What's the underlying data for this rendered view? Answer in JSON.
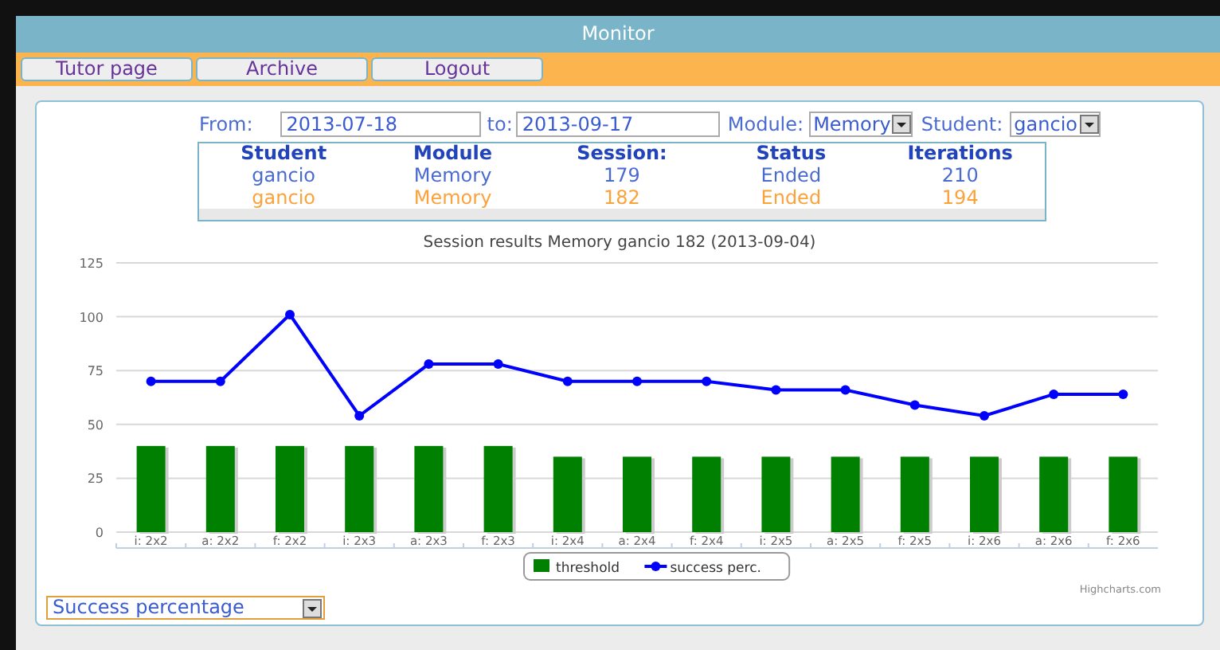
{
  "window": {
    "title": "Monitor"
  },
  "nav": [
    "Tutor page",
    "Archive",
    "Logout"
  ],
  "filters": {
    "from_label": "From:",
    "from": "2013-07-18",
    "to_label": "to:",
    "to": "2013-09-17",
    "module_label": "Module:",
    "module": "Memory",
    "student_label": "Student:",
    "student": "gancio"
  },
  "sessions": {
    "columns": [
      "Student",
      "Module",
      "Session:",
      "Status",
      "Iterations"
    ],
    "rows": [
      {
        "cells": [
          "gancio",
          "Memory",
          "179",
          "Ended",
          "210"
        ],
        "selected": false
      },
      {
        "cells": [
          "gancio",
          "Memory",
          "182",
          "Ended",
          "194"
        ],
        "selected": true
      }
    ]
  },
  "chart": {
    "chart_data": {
      "type": "bar",
      "title": "Session results Memory gancio 182 (2013-09-04)",
      "categories": [
        "i: 2x2",
        "a: 2x2",
        "f: 2x2",
        "i: 2x3",
        "a: 2x3",
        "f: 2x3",
        "i: 2x4",
        "a: 2x4",
        "f: 2x4",
        "i: 2x5",
        "a: 2x5",
        "f: 2x5",
        "i: 2x6",
        "a: 2x6",
        "f: 2x6"
      ],
      "series": [
        {
          "name": "threshold",
          "color": "#008000",
          "values": [
            40,
            40,
            40,
            40,
            40,
            40,
            35,
            35,
            35,
            35,
            35,
            35,
            35,
            35,
            35
          ]
        },
        {
          "name": "success perc.",
          "color": "#0000ff",
          "type": "line",
          "marker": true,
          "values": [
            70,
            70,
            101,
            54,
            78,
            78,
            70,
            70,
            70,
            66,
            66,
            59,
            54,
            64,
            64
          ]
        }
      ],
      "grid": true,
      "legend": "bottom",
      "ylim": [
        0,
        125
      ],
      "yticks": [
        0,
        25,
        50,
        75,
        100,
        125
      ]
    },
    "credit": "Highcharts.com"
  },
  "metric_select": {
    "value": "Success percentage"
  }
}
